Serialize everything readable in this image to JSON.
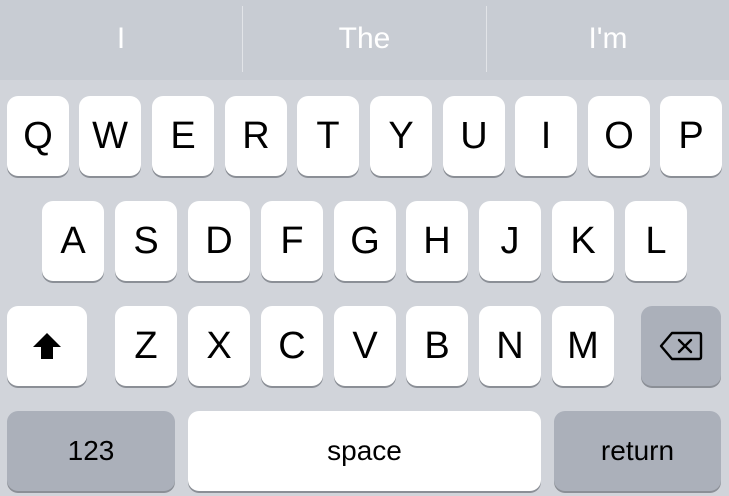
{
  "suggestions": [
    "I",
    "The",
    "I'm"
  ],
  "keyboard": {
    "row1": [
      "Q",
      "W",
      "E",
      "R",
      "T",
      "Y",
      "U",
      "I",
      "O",
      "P"
    ],
    "row2": [
      "A",
      "S",
      "D",
      "F",
      "G",
      "H",
      "J",
      "K",
      "L"
    ],
    "row3": [
      "Z",
      "X",
      "C",
      "V",
      "B",
      "N",
      "M"
    ],
    "numbers_label": "123",
    "space_label": "space",
    "return_label": "return"
  },
  "icons": {
    "shift": "shift-arrow-icon",
    "delete": "delete-backspace-icon"
  },
  "colors": {
    "background": "#d1d4da",
    "suggestion_bar": "#c8ccd3",
    "key": "#ffffff",
    "function_key": "#abb0ba",
    "key_text": "#000000"
  }
}
